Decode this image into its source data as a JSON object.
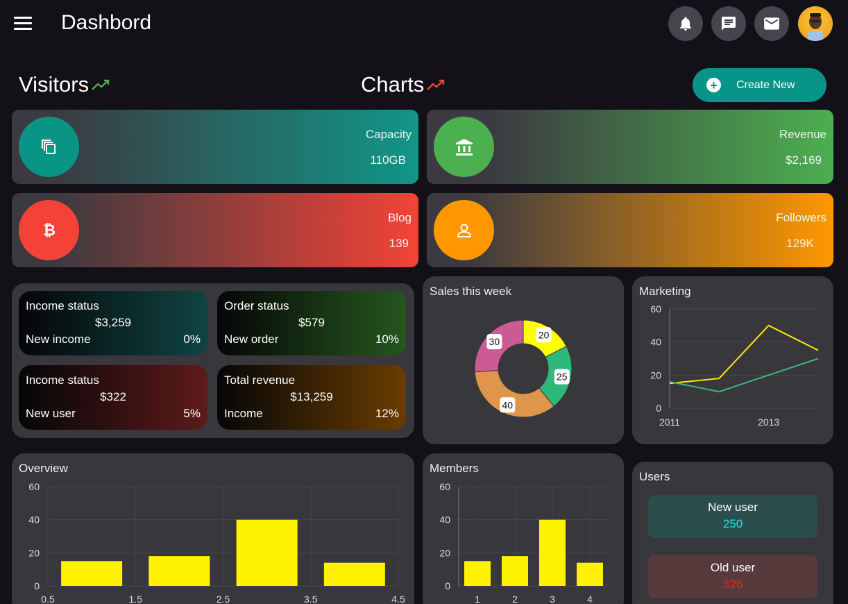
{
  "header": {
    "title": "Dashbord"
  },
  "sections": {
    "visitors": "Visitors",
    "charts": "Charts",
    "create_label": "Create New"
  },
  "stats": [
    {
      "label": "Capacity",
      "value": "110GB"
    },
    {
      "label": "Revenue",
      "value": "$2,169"
    },
    {
      "label": "Blog",
      "value": "139"
    },
    {
      "label": "Followers",
      "value": "129K"
    }
  ],
  "status_cards": [
    {
      "title": "Income status",
      "value": "$3,259",
      "sub": "New income",
      "pct": "0%"
    },
    {
      "title": "Order status",
      "value": "$579",
      "sub": "New order",
      "pct": "10%"
    },
    {
      "title": "Income status",
      "value": "$322",
      "sub": "New user",
      "pct": "5%"
    },
    {
      "title": "Total revenue",
      "value": "$13,259",
      "sub": "Income",
      "pct": "12%"
    }
  ],
  "users": {
    "title": "Users",
    "new_label": "New user",
    "new_value": "250",
    "old_label": "Old user",
    "old_value": "326"
  },
  "colors": {
    "teal": "#089488",
    "green": "#4caf50",
    "red": "#f44336",
    "orange": "#ff9800"
  },
  "chart_data": [
    {
      "type": "pie",
      "title": "Sales this week",
      "values": [
        20,
        25,
        40,
        30
      ],
      "colors": [
        "#ffff00",
        "#2eb87a",
        "#e0964a",
        "#cc5a94"
      ]
    },
    {
      "type": "line",
      "title": "Marketing",
      "x": [
        2011,
        2012,
        2013,
        2014
      ],
      "xticks": [
        "2011",
        "2013"
      ],
      "yticks": [
        0,
        20,
        40,
        60
      ],
      "ylim": [
        0,
        60
      ],
      "series": [
        {
          "values": [
            15,
            18,
            50,
            35
          ],
          "color": "#ffea00"
        },
        {
          "values": [
            16,
            10,
            20,
            30
          ],
          "color": "#3cb878"
        }
      ]
    },
    {
      "type": "bar",
      "title": "Overview",
      "x": [
        1,
        2,
        3,
        4
      ],
      "values": [
        15,
        18,
        40,
        14
      ],
      "xticks": [
        "0.5",
        "1.5",
        "2.5",
        "3.5",
        "4.5"
      ],
      "yticks": [
        0,
        20,
        40,
        60
      ],
      "ylim": [
        0,
        60
      ]
    },
    {
      "type": "bar",
      "title": "Members",
      "x": [
        1,
        2,
        3,
        4
      ],
      "values": [
        15,
        18,
        40,
        14
      ],
      "xticks": [
        "1",
        "2",
        "3",
        "4"
      ],
      "yticks": [
        0,
        20,
        40,
        60
      ],
      "ylim": [
        0,
        60
      ]
    }
  ]
}
